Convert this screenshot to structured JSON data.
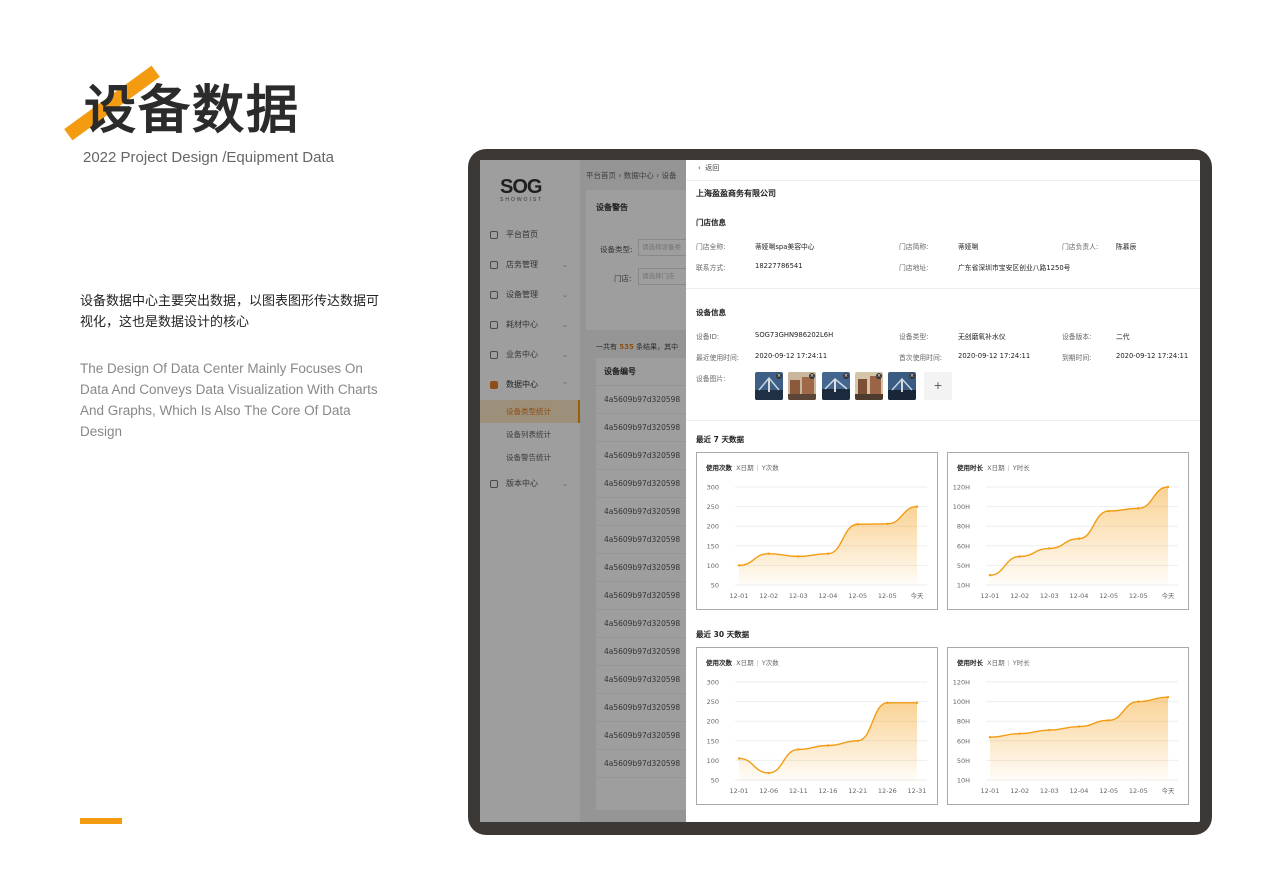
{
  "intro": {
    "title": "设备数据",
    "subtitle": "2022 Project Design /Equipment Data",
    "desc_cn": "设备数据中心主要突出数据，以图表图形传达数据可视化，这也是数据设计的核心",
    "desc_en": "The Design Of Data Center Mainly Focuses On Data And Conveys Data Visualization With Charts And Graphs, Which Is Also The Core Of Data Design",
    "accent": "#f39c12"
  },
  "app": {
    "logo": "SOG",
    "logo_sub": "SHOWOIST",
    "nav": [
      {
        "label": "平台首页",
        "icon": "home-icon"
      },
      {
        "label": "店务管理",
        "icon": "store-icon"
      },
      {
        "label": "设备管理",
        "icon": "device-icon"
      },
      {
        "label": "耗材中心",
        "icon": "material-icon"
      },
      {
        "label": "业务中心",
        "icon": "business-icon"
      },
      {
        "label": "数据中心",
        "icon": "data-icon"
      }
    ],
    "subnav": [
      "设备类型统计",
      "设备列表统计",
      "设备警告统计"
    ],
    "nav_last": "版本中心",
    "breadcrumb": "平台首页  ›  数据中心  ›  设备",
    "panel_title": "设备警告",
    "filter_type_label": "设备类型:",
    "filter_type_placeholder": "请选择设备类",
    "filter_store_label": "门店:",
    "filter_store_placeholder": "请选择门店",
    "result_prefix": "一共有",
    "result_count": "535",
    "result_suffix": "条结果，其中",
    "table_header": "设备编号",
    "rows": [
      "4a5609b97d320598",
      "4a5609b97d320598",
      "4a5609b97d320598",
      "4a5609b97d320598",
      "4a5609b97d320598",
      "4a5609b97d320598",
      "4a5609b97d320598",
      "4a5609b97d320598",
      "4a5609b97d320598",
      "4a5609b97d320598",
      "4a5609b97d320598",
      "4a5609b97d320598",
      "4a5609b97d320598",
      "4a5609b97d320598"
    ]
  },
  "drawer": {
    "back": "返回",
    "company": "上海盈盈商务有限公司",
    "store_section": "门店信息",
    "store": {
      "full_name_label": "门店全称:",
      "full_name": "蒂娅唎spa美容中心",
      "short_name_label": "门店简称:",
      "short_name": "蒂娅唎",
      "owner_label": "门店负责人:",
      "owner": "陈慕辰",
      "contact_label": "联系方式:",
      "contact": "18227786541",
      "address_label": "门店地址:",
      "address": "广东省深圳市宝安区创业八路1250号"
    },
    "device_section": "设备信息",
    "device": {
      "id_label": "设备ID:",
      "id": "SOG73GHN986202L6H",
      "type_label": "设备类型:",
      "type": "无创磨氧补水仪",
      "version_label": "设备版本:",
      "version": "二代",
      "last_used_label": "最近使用时间:",
      "last_used": "2020-09-12  17:24:11",
      "first_used_label": "首次使用时间:",
      "first_used": "2020-09-12  17:24:11",
      "expire_label": "到期时间:",
      "expire": "2020-09-12  17:24:11",
      "images_label": "设备图片:",
      "add": "+"
    },
    "week_title": "最近 7 天数据",
    "month_title": "最近 30 天数据",
    "x_meta": "X日期",
    "y_count_meta": "Y次数",
    "y_time_meta": "Y时长"
  },
  "chart_data": [
    {
      "type": "area",
      "title": "使用次数",
      "categories": [
        "12-01",
        "12-02",
        "12-03",
        "12-04",
        "12-05",
        "12-05",
        "今天"
      ],
      "yticks": [
        "300",
        "250",
        "200",
        "150",
        "100",
        "50"
      ],
      "ylim": [
        50,
        300
      ],
      "values": [
        100,
        130,
        123,
        130,
        205,
        206,
        250
      ],
      "color": "#f39c12"
    },
    {
      "type": "area",
      "title": "使用时长",
      "categories": [
        "12-01",
        "12-02",
        "12-03",
        "12-04",
        "12-05",
        "12-05",
        "今天"
      ],
      "yticks": [
        "120H",
        "100H",
        "80H",
        "60H",
        "50H",
        "10H"
      ],
      "ylim": [
        10,
        120
      ],
      "values": [
        21,
        42,
        51,
        62,
        93,
        96,
        120
      ],
      "color": "#f39c12"
    },
    {
      "type": "area",
      "title": "使用次数",
      "categories": [
        "12-01",
        "12-06",
        "12-11",
        "12-16",
        "12-21",
        "12-26",
        "12-31"
      ],
      "yticks": [
        "300",
        "250",
        "200",
        "150",
        "100",
        "50"
      ],
      "ylim": [
        50,
        300
      ],
      "values": [
        105,
        68,
        128,
        138,
        150,
        247,
        247
      ],
      "color": "#f39c12"
    },
    {
      "type": "area",
      "title": "使用时长",
      "categories": [
        "12-01",
        "12-02",
        "12-03",
        "12-04",
        "12-05",
        "12-05",
        "今天"
      ],
      "yticks": [
        "120H",
        "100H",
        "80H",
        "60H",
        "50H",
        "10H"
      ],
      "ylim": [
        10,
        120
      ],
      "values": [
        58,
        62,
        66,
        70,
        77,
        98,
        103
      ],
      "color": "#f39c12"
    }
  ]
}
